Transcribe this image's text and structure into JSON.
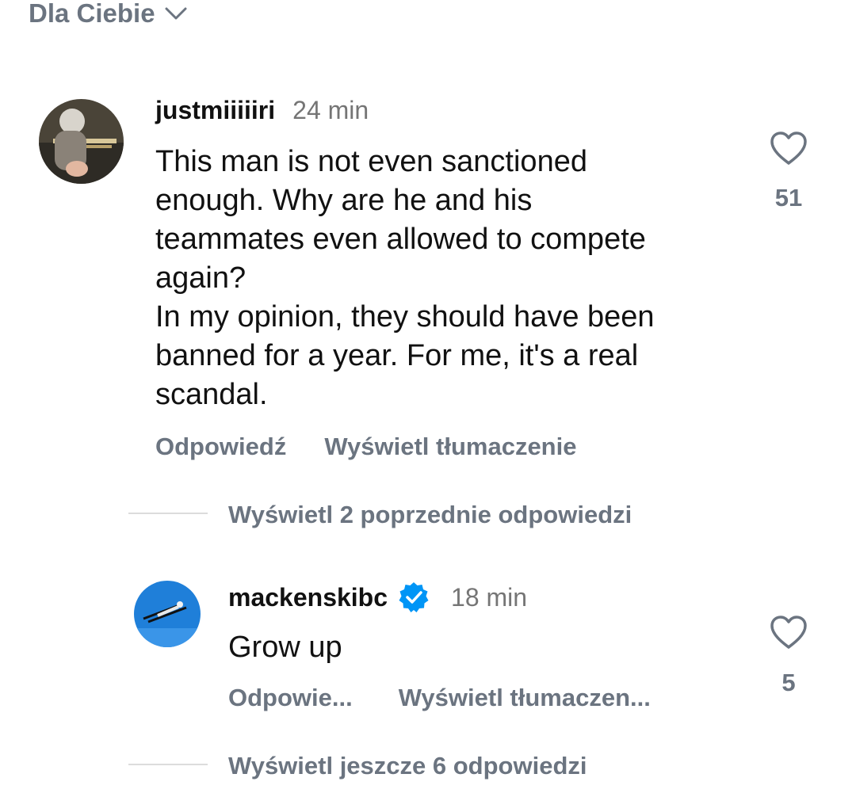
{
  "filter": {
    "label": "Dla Ciebie"
  },
  "comment1": {
    "username": "justmiiiiiri",
    "time": "24 min",
    "text": "This man is not even sanctioned\nenough. Why are he and his\nteammates even allowed to compete\nagain?\nIn my opinion, they should have been\nbanned for a year. For me, it's a real\nscandal.",
    "reply_label": "Odpowiedź",
    "translate_label": "Wyświetl tłumaczenie",
    "likes": "51"
  },
  "view_previous": "Wyświetl 2 poprzednie odpowiedzi",
  "reply1": {
    "username": "mackenskibc",
    "time": "18 min",
    "text": "Grow up",
    "reply_label": "Odpowie...",
    "translate_label": "Wyświetl tłumaczen...",
    "likes": "5"
  },
  "view_more": "Wyświetl jeszcze 6 odpowiedzi",
  "colors": {
    "verified": "#0095f6",
    "muted": "#6b7480"
  },
  "icons": {
    "chevron": "chevron-down-icon",
    "heart": "heart-icon",
    "verified": "verified-badge-icon"
  }
}
